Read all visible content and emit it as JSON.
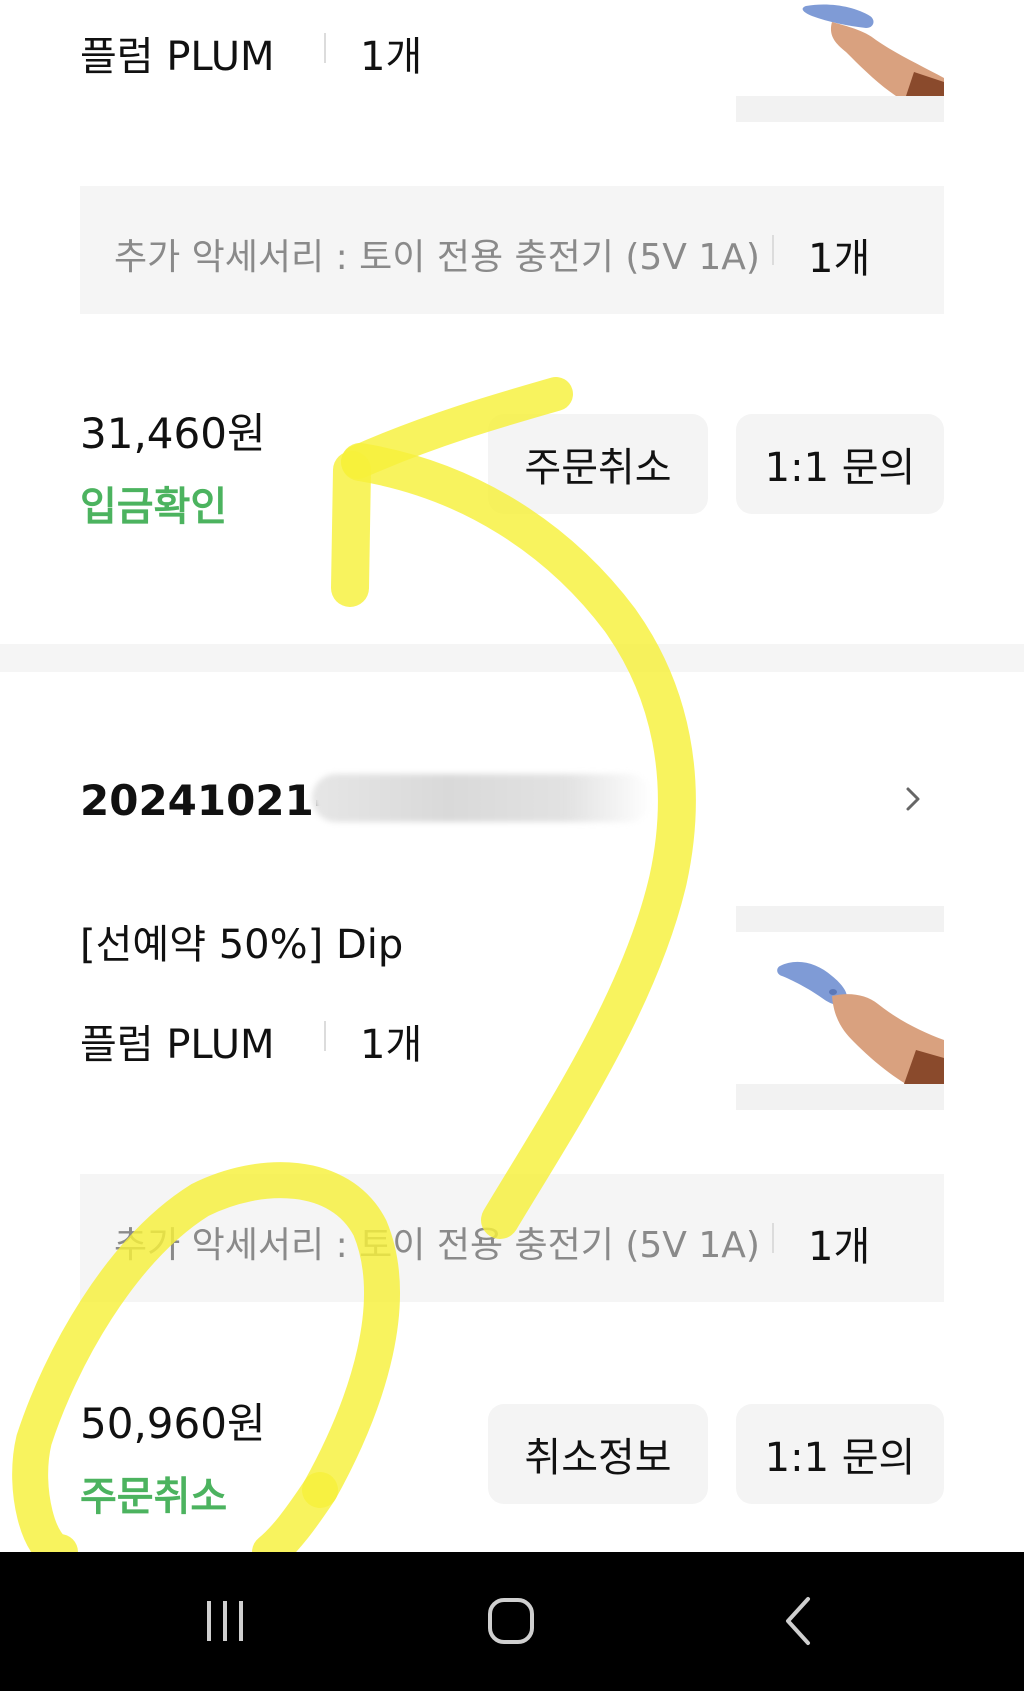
{
  "orders": [
    {
      "option_name": "플럼 PLUM",
      "option_qty": "1개",
      "accessory_label": "추가 악세서리 : 토이 전용 충전기 (5V 1A)",
      "accessory_qty": "1개",
      "price": "31,460원",
      "status": "입금확인",
      "buttons": {
        "primary": "주문취소",
        "inquiry": "1:1 문의"
      }
    },
    {
      "order_number": "20241021-",
      "product_title": "[선예약 50%] Dip",
      "option_name": "플럼 PLUM",
      "option_qty": "1개",
      "accessory_label": "추가 악세서리 : 토이 전용 충전기 (5V 1A)",
      "accessory_qty": "1개",
      "price": "50,960원",
      "status": "주문취소",
      "buttons": {
        "primary": "취소정보",
        "inquiry": "1:1 문의"
      }
    }
  ],
  "icons": {
    "order_detail": "chevron-right-icon",
    "product_image": "product-photo-hand-holding-toy",
    "nav_recent": "recent-apps-icon",
    "nav_home": "home-icon",
    "nav_back": "back-icon"
  },
  "colors": {
    "status_green": "#4cb35f",
    "highlight_yellow": "#f7f03a",
    "navbar": "#000000",
    "button_bg": "#f4f4f4",
    "accessory_bg": "#f5f5f5"
  }
}
